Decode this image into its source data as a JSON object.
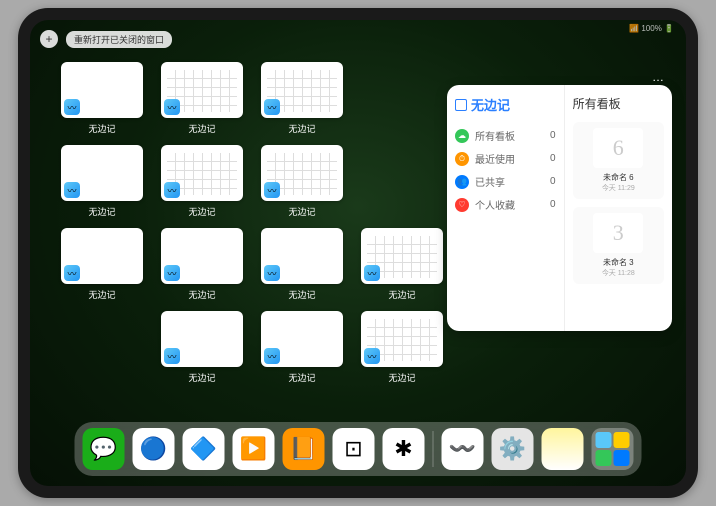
{
  "status": {
    "text": "📶 100% 🔋"
  },
  "topbar": {
    "plus": "+",
    "reopen_label": "重新打开已关闭的窗口"
  },
  "thumbs": [
    {
      "label": "无边记",
      "type": "blank"
    },
    {
      "label": "无边记",
      "type": "cal"
    },
    {
      "label": "无边记",
      "type": "cal"
    },
    {
      "label": "无边记",
      "type": "blank"
    },
    {
      "label": "无边记",
      "type": "cal"
    },
    {
      "label": "无边记",
      "type": "cal"
    },
    {
      "label": "无边记",
      "type": "blank"
    },
    {
      "label": "无边记",
      "type": "blank"
    },
    {
      "label": "无边记",
      "type": "blank"
    },
    {
      "label": "无边记",
      "type": "cal"
    },
    {
      "label": "无边记",
      "type": "blank"
    },
    {
      "label": "无边记",
      "type": "blank"
    },
    {
      "label": "无边记",
      "type": "cal"
    }
  ],
  "thumb_positions": [
    0,
    1,
    2,
    4,
    5,
    6,
    8,
    9,
    10,
    11,
    13,
    14,
    15
  ],
  "panel": {
    "more": "…",
    "title": "无边记",
    "categories": [
      {
        "label": "所有看板",
        "color": "#34c759",
        "icon": "☁",
        "count": "0"
      },
      {
        "label": "最近使用",
        "color": "#ff9500",
        "icon": "⏱",
        "count": "0"
      },
      {
        "label": "已共享",
        "color": "#007aff",
        "icon": "👥",
        "count": "0"
      },
      {
        "label": "个人收藏",
        "color": "#ff3b30",
        "icon": "♡",
        "count": "0"
      }
    ],
    "right_title": "所有看板",
    "boards": [
      {
        "glyph": "6",
        "label": "未命名 6",
        "sub": "今天 11:29"
      },
      {
        "glyph": "3",
        "label": "未命名 3",
        "sub": "今天 11:28"
      }
    ]
  },
  "dock": {
    "apps": [
      {
        "name": "wechat",
        "bg": "#1aad19",
        "glyph": "💬"
      },
      {
        "name": "quark",
        "bg": "#ffffff",
        "glyph": "🔵"
      },
      {
        "name": "qqbrowser",
        "bg": "#ffffff",
        "glyph": "🔷"
      },
      {
        "name": "play",
        "bg": "#ffffff",
        "glyph": "▶️"
      },
      {
        "name": "books",
        "bg": "#ff9500",
        "glyph": "📙"
      },
      {
        "name": "dice",
        "bg": "#ffffff",
        "glyph": "⊡"
      },
      {
        "name": "connect",
        "bg": "#ffffff",
        "glyph": "✱"
      }
    ],
    "recent": [
      {
        "name": "freeform",
        "bg": "#ffffff",
        "glyph": "〰️"
      },
      {
        "name": "settings",
        "bg": "#e5e5e5",
        "glyph": "⚙️"
      },
      {
        "name": "notes",
        "bg": "linear-gradient(#fff59d,#fff)",
        "glyph": ""
      }
    ]
  }
}
